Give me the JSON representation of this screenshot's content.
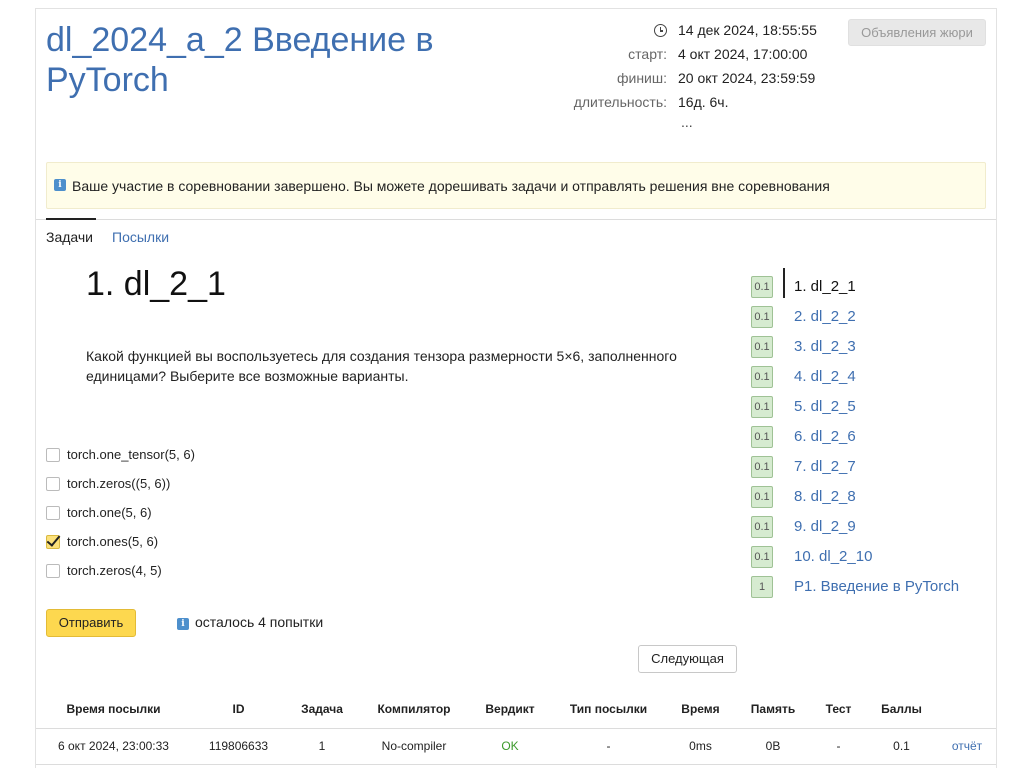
{
  "contest": {
    "title": "dl_2024_a_2 Введение в PyTorch",
    "current_time": "14 дек 2024, 18:55:55",
    "start_label": "старт:",
    "start_value": "4 окт 2024, 17:00:00",
    "finish_label": "финиш:",
    "finish_value": "20 окт 2024, 23:59:59",
    "duration_label": "длительность:",
    "duration_value": "16д. 6ч.",
    "more": "...",
    "jury_button": "Объявления жюри"
  },
  "notice": {
    "icon": "info-icon",
    "text": "Ваше участие в соревновании завершено. Вы можете дорешивать задачи и отправлять решения вне соревнования"
  },
  "tabs": [
    {
      "label": "Задачи",
      "active": true
    },
    {
      "label": "Посылки",
      "active": false
    }
  ],
  "problem": {
    "title": "1. dl_2_1",
    "statement": "Какой функцией вы воспользуетесь для создания тензора размерности 5×6, заполненного единицами? Выберите все возможные варианты.",
    "options": [
      {
        "label": "torch.one_tensor(5, 6)",
        "checked": false
      },
      {
        "label": "torch.zeros((5, 6))",
        "checked": false
      },
      {
        "label": "torch.one(5, 6)",
        "checked": false
      },
      {
        "label": "torch.ones(5, 6)",
        "checked": true
      },
      {
        "label": "torch.zeros(4, 5)",
        "checked": false
      }
    ],
    "submit_label": "Отправить",
    "attempts_text": "осталось 4 попытки",
    "next_label": "Следующая"
  },
  "problem_list": [
    {
      "score": "0.1",
      "name": "1. dl_2_1",
      "current": true
    },
    {
      "score": "0.1",
      "name": "2. dl_2_2",
      "current": false
    },
    {
      "score": "0.1",
      "name": "3. dl_2_3",
      "current": false
    },
    {
      "score": "0.1",
      "name": "4. dl_2_4",
      "current": false
    },
    {
      "score": "0.1",
      "name": "5. dl_2_5",
      "current": false
    },
    {
      "score": "0.1",
      "name": "6. dl_2_6",
      "current": false
    },
    {
      "score": "0.1",
      "name": "7. dl_2_7",
      "current": false
    },
    {
      "score": "0.1",
      "name": "8. dl_2_8",
      "current": false
    },
    {
      "score": "0.1",
      "name": "9. dl_2_9",
      "current": false
    },
    {
      "score": "0.1",
      "name": "10. dl_2_10",
      "current": false
    },
    {
      "score": "1",
      "name": "P1. Введение в PyTorch",
      "current": false
    }
  ],
  "submissions": {
    "columns": [
      "Время посылки",
      "ID",
      "Задача",
      "Компилятор",
      "Вердикт",
      "Тип посылки",
      "Время",
      "Память",
      "Тест",
      "Баллы",
      ""
    ],
    "rows": [
      {
        "time": "6 окт 2024, 23:00:33",
        "id": "119806633",
        "problem": "1",
        "compiler": "No-compiler",
        "verdict": "OK",
        "type": "-",
        "runtime": "0ms",
        "memory": "0B",
        "test": "-",
        "score": "0.1",
        "report": "отчёт"
      }
    ]
  },
  "colors": {
    "link": "#3f6fb0",
    "accent_button": "#fdd84f",
    "badge_bg": "#d6ebd0",
    "verdict_ok": "#3c9a2b",
    "notice_bg": "#fffde9"
  }
}
